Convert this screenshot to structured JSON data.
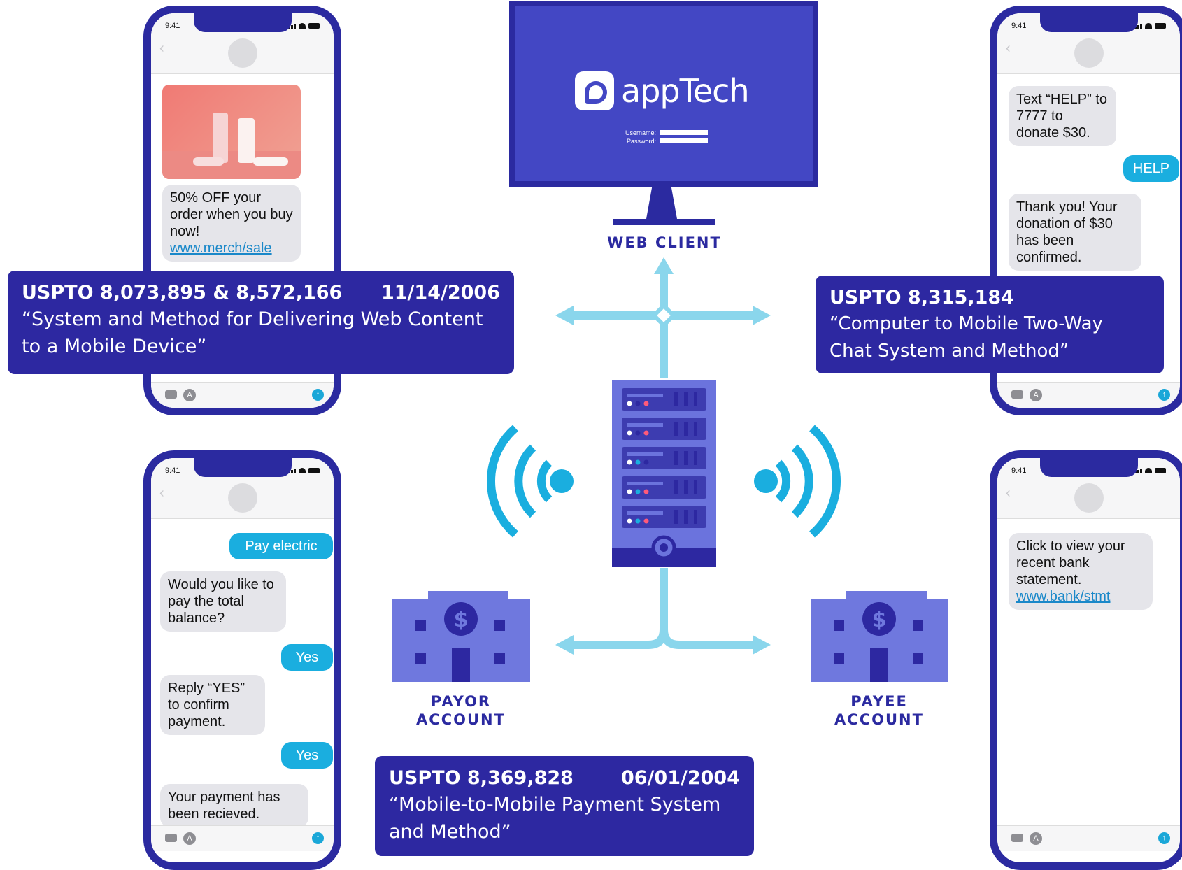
{
  "phone_status_time": "9:41",
  "web_client": {
    "logo_text": "appTech",
    "username_label": "Username:",
    "password_label": "Password:",
    "label": "WEB CLIENT"
  },
  "phone_tl": {
    "promo": "50% OFF your order when you buy now!",
    "link": "www.merch/sale"
  },
  "phone_tr": {
    "msg1": "Text “HELP” to 7777 to donate $30.",
    "reply": "HELP",
    "msg2": "Thank you! Your donation of $30 has been confirmed."
  },
  "phone_bl": {
    "out1": "Pay electric",
    "in1": "Would you like to pay the total balance?",
    "out2": "Yes",
    "in2": "Reply “YES” to confirm payment.",
    "out3": "Yes",
    "in3": "Your payment has been recieved."
  },
  "phone_br": {
    "msg": "Click to view your recent bank statement.",
    "link": "www.bank/stmt"
  },
  "patents": [
    {
      "number": "USPTO 8,073,895 & 8,572,166",
      "date": "11/14/2006",
      "title": "“System and Method for Delivering Web Content to a Mobile Device”"
    },
    {
      "number": "USPTO 8,315,184",
      "date": "",
      "title": "“Computer to Mobile Two-Way Chat System and Method”"
    },
    {
      "number": "USPTO 8,369,828",
      "date": "06/01/2004",
      "title": "“Mobile-to-Mobile Payment System and Method”"
    }
  ],
  "accounts": {
    "payor_line1": "PAYOR",
    "payor_line2": "ACCOUNT",
    "payee_line1": "PAYEE",
    "payee_line2": "ACCOUNT",
    "currency_symbol": "$"
  },
  "colors": {
    "navy": "#2d28a1",
    "monitor_blue": "#4347c4",
    "cyan": "#1aaedf",
    "light_cyan": "#8ad6ec",
    "building_blue": "#6f78de",
    "server_blue": "#6b73dd"
  },
  "icons": [
    "camera-icon",
    "app-store-icon",
    "send-arrow-icon",
    "wifi-signal-icon",
    "server-icon",
    "bank-building-icon",
    "monitor-icon"
  ]
}
